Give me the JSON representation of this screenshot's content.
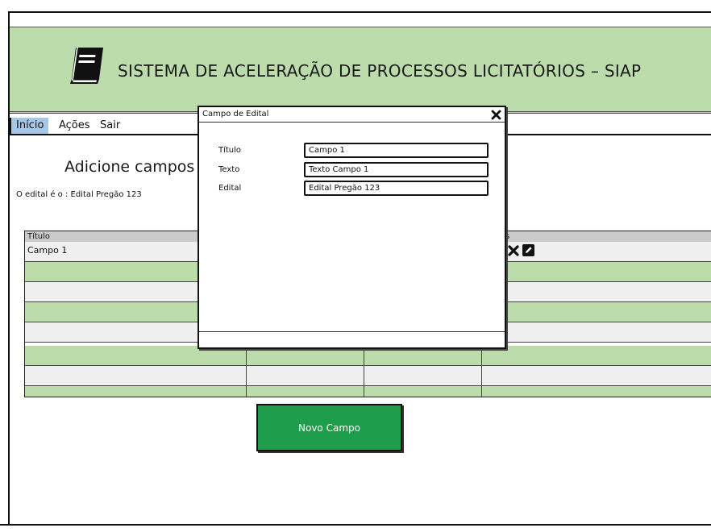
{
  "header": {
    "title": "SISTEMA DE ACELERAÇÃO DE PROCESSOS LICITATÓRIOS – SIAP",
    "logo_icon": "book-icon"
  },
  "menu": {
    "items": [
      {
        "label": "Início",
        "active": true
      },
      {
        "label": "Ações",
        "active": false
      },
      {
        "label": "Sair",
        "active": false
      }
    ]
  },
  "main": {
    "heading": "Adicione campos",
    "edital_line": "O edital é o : Edital Pregão 123"
  },
  "table": {
    "columns": [
      "Título",
      "",
      "",
      "s"
    ],
    "rows": [
      {
        "titulo": "Campo 1",
        "actions": [
          "delete-icon",
          "edit-icon"
        ]
      }
    ],
    "row_count": 7
  },
  "new_button": {
    "label": "Novo Campo"
  },
  "modal": {
    "title": "Campo de Edital",
    "close_icon": "close-icon",
    "fields": [
      {
        "label": "Título",
        "value": "Campo 1"
      },
      {
        "label": "Texto",
        "value": "Texto Campo 1"
      },
      {
        "label": "Edital",
        "value": "Edital Pregão 123"
      }
    ]
  },
  "colors": {
    "header_bg": "#bcdcab",
    "row_green": "#bcdcab",
    "row_white": "#efefef",
    "menu_active": "#a7c7e7",
    "button_green": "#1e9d4a"
  }
}
